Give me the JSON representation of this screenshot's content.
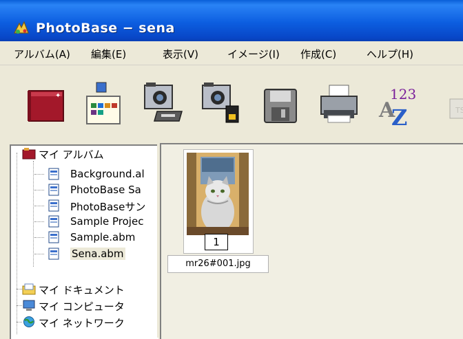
{
  "window": {
    "title": "PhotoBase − sena"
  },
  "menu": [
    {
      "label": "アルバム(A)"
    },
    {
      "label": "編集(E)"
    },
    {
      "label": "表示(V)"
    },
    {
      "label": "イメージ(I)"
    },
    {
      "label": "作成(C)"
    },
    {
      "label": "ヘルプ(H)"
    }
  ],
  "toolbar": {
    "buttons": [
      {
        "icon": "album-book-icon"
      },
      {
        "icon": "slideshow-card-icon"
      },
      {
        "icon": "camera-scanner-icon"
      },
      {
        "icon": "camera-card-icon"
      },
      {
        "icon": "save-disk-icon"
      },
      {
        "icon": "printer-icon"
      },
      {
        "icon": "sort-az-icon",
        "badge": "123"
      },
      {
        "icon": "more-icon"
      }
    ]
  },
  "tree": {
    "root": "マイ アルバム",
    "albums": [
      "Background.al",
      "PhotoBase Sa",
      "PhotoBaseサン",
      "Sample Projec",
      "Sample.abm",
      "Sena.abm"
    ],
    "others": [
      "マイ ドキュメント",
      "マイ コンピュータ",
      "マイ ネットワーク"
    ]
  },
  "thumbnail": {
    "number": "1",
    "filename": "mr26#001.jpg"
  }
}
